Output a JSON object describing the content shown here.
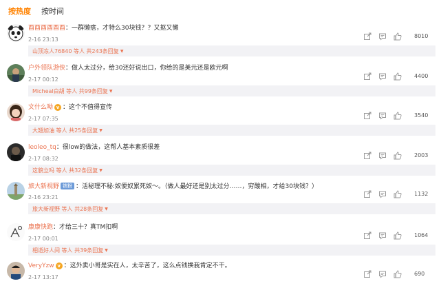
{
  "tabs": [
    {
      "label": "按热度",
      "active": true
    },
    {
      "label": "按时间",
      "active": false
    }
  ],
  "comments": [
    {
      "user": "酉酉酉酉酉酉",
      "text": "：一群懒瘩，才特么30块钱？？又抠又懒",
      "date": "2-16 23:13",
      "likes": "8010",
      "reply": "山顶冻人76840 等人 共243条回复",
      "avatar": "panda",
      "badge": null,
      "vip": false
    },
    {
      "user": "户外领队游侠",
      "text": "：做人太过分，给30还好说出口，你给的是美元还是欧元啊",
      "date": "2-17 00:12",
      "likes": "4400",
      "reply": "Micheal白胡 等人 共99条回复",
      "avatar": "outdoor",
      "badge": null,
      "vip": false
    },
    {
      "user": "文什么呦",
      "text": "：这个不值得宣传",
      "date": "2-17 07:35",
      "likes": "3540",
      "reply": "大翘加油 等人 共25条回复",
      "avatar": "girl",
      "badge": null,
      "vip": true
    },
    {
      "user": "leoleo_tq",
      "text": "：很low的做法，这帮人基本素质很差",
      "date": "2-17 08:32",
      "likes": "2003",
      "reply": "这貌立吗 等人 共32条回复",
      "avatar": "dark",
      "badge": null,
      "vip": false
    },
    {
      "user": "旅大新视野",
      "text": "：活秘理不秘:奴便奴累死奴～。（做人最好还是别太过分……，穷酸相，才给30块钱？）",
      "date": "2-16 23:21",
      "likes": "1132",
      "reply": "旅大新视野 等人 共28条回复",
      "avatar": "tower",
      "badge": "铁粉",
      "vip": false
    },
    {
      "user": "康康快跑",
      "text": "：才给三十？真TM扣啊",
      "date": "2-17 00:01",
      "likes": "1064",
      "reply": "相逝好人间 等人 共39条回复",
      "avatar": "sketch",
      "badge": null,
      "vip": false
    },
    {
      "user": "VeryYzw",
      "text": "：这外卖小哥是实在人，太辛苦了，这么点钱换我肯定不干。",
      "date": "2-17 13:17",
      "likes": "690",
      "reply": null,
      "avatar": "man",
      "badge": null,
      "vip": true
    }
  ],
  "icons": {
    "share": "share-icon",
    "comment": "comment-icon",
    "like": "thumbs-up-icon"
  },
  "colors": {
    "accent": "#ff8200",
    "username": "#eb7350",
    "reply_bg": "#f2f2f5",
    "badge": "#6d9bd8"
  }
}
